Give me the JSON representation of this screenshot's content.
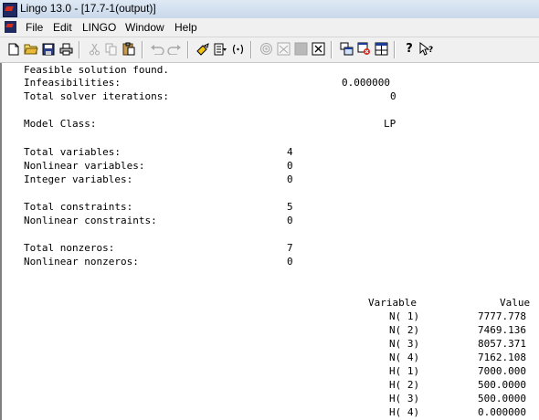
{
  "window": {
    "title": "Lingo 13.0 - [17.7-1(output)]"
  },
  "menu": {
    "items": [
      "File",
      "Edit",
      "LINGO",
      "Window",
      "Help"
    ]
  },
  "toolbar": {
    "about_glyph": "?"
  },
  "report": {
    "status": "Feasible solution found.",
    "infeasibilities": {
      "label": "Infeasibilities:",
      "value": "0.000000"
    },
    "iterations": {
      "label": "Total solver iterations:",
      "value": "0"
    },
    "model_class": {
      "label": "Model Class:",
      "value": "LP"
    },
    "total_variables": {
      "label": "Total variables:",
      "value": "4"
    },
    "nonlinear_variables": {
      "label": "Nonlinear variables:",
      "value": "0"
    },
    "integer_variables": {
      "label": "Integer variables:",
      "value": "0"
    },
    "total_constraints": {
      "label": "Total constraints:",
      "value": "5"
    },
    "nonlinear_constraints": {
      "label": "Nonlinear constraints:",
      "value": "0"
    },
    "total_nonzeros": {
      "label": "Total nonzeros:",
      "value": "7"
    },
    "nonlinear_nonzeros": {
      "label": "Nonlinear nonzeros:",
      "value": "0"
    },
    "table": {
      "headers": {
        "variable": "Variable",
        "value": "Value"
      },
      "rows": [
        {
          "variable": "N( 1)",
          "value": "7777.778"
        },
        {
          "variable": "N( 2)",
          "value": "7469.136"
        },
        {
          "variable": "N( 3)",
          "value": "8057.371"
        },
        {
          "variable": "N( 4)",
          "value": "7162.108"
        },
        {
          "variable": "H( 1)",
          "value": "7000.000"
        },
        {
          "variable": "H( 2)",
          "value": "500.0000"
        },
        {
          "variable": "H( 3)",
          "value": "500.0000"
        },
        {
          "variable": "H( 4)",
          "value": "0.000000"
        }
      ]
    }
  }
}
